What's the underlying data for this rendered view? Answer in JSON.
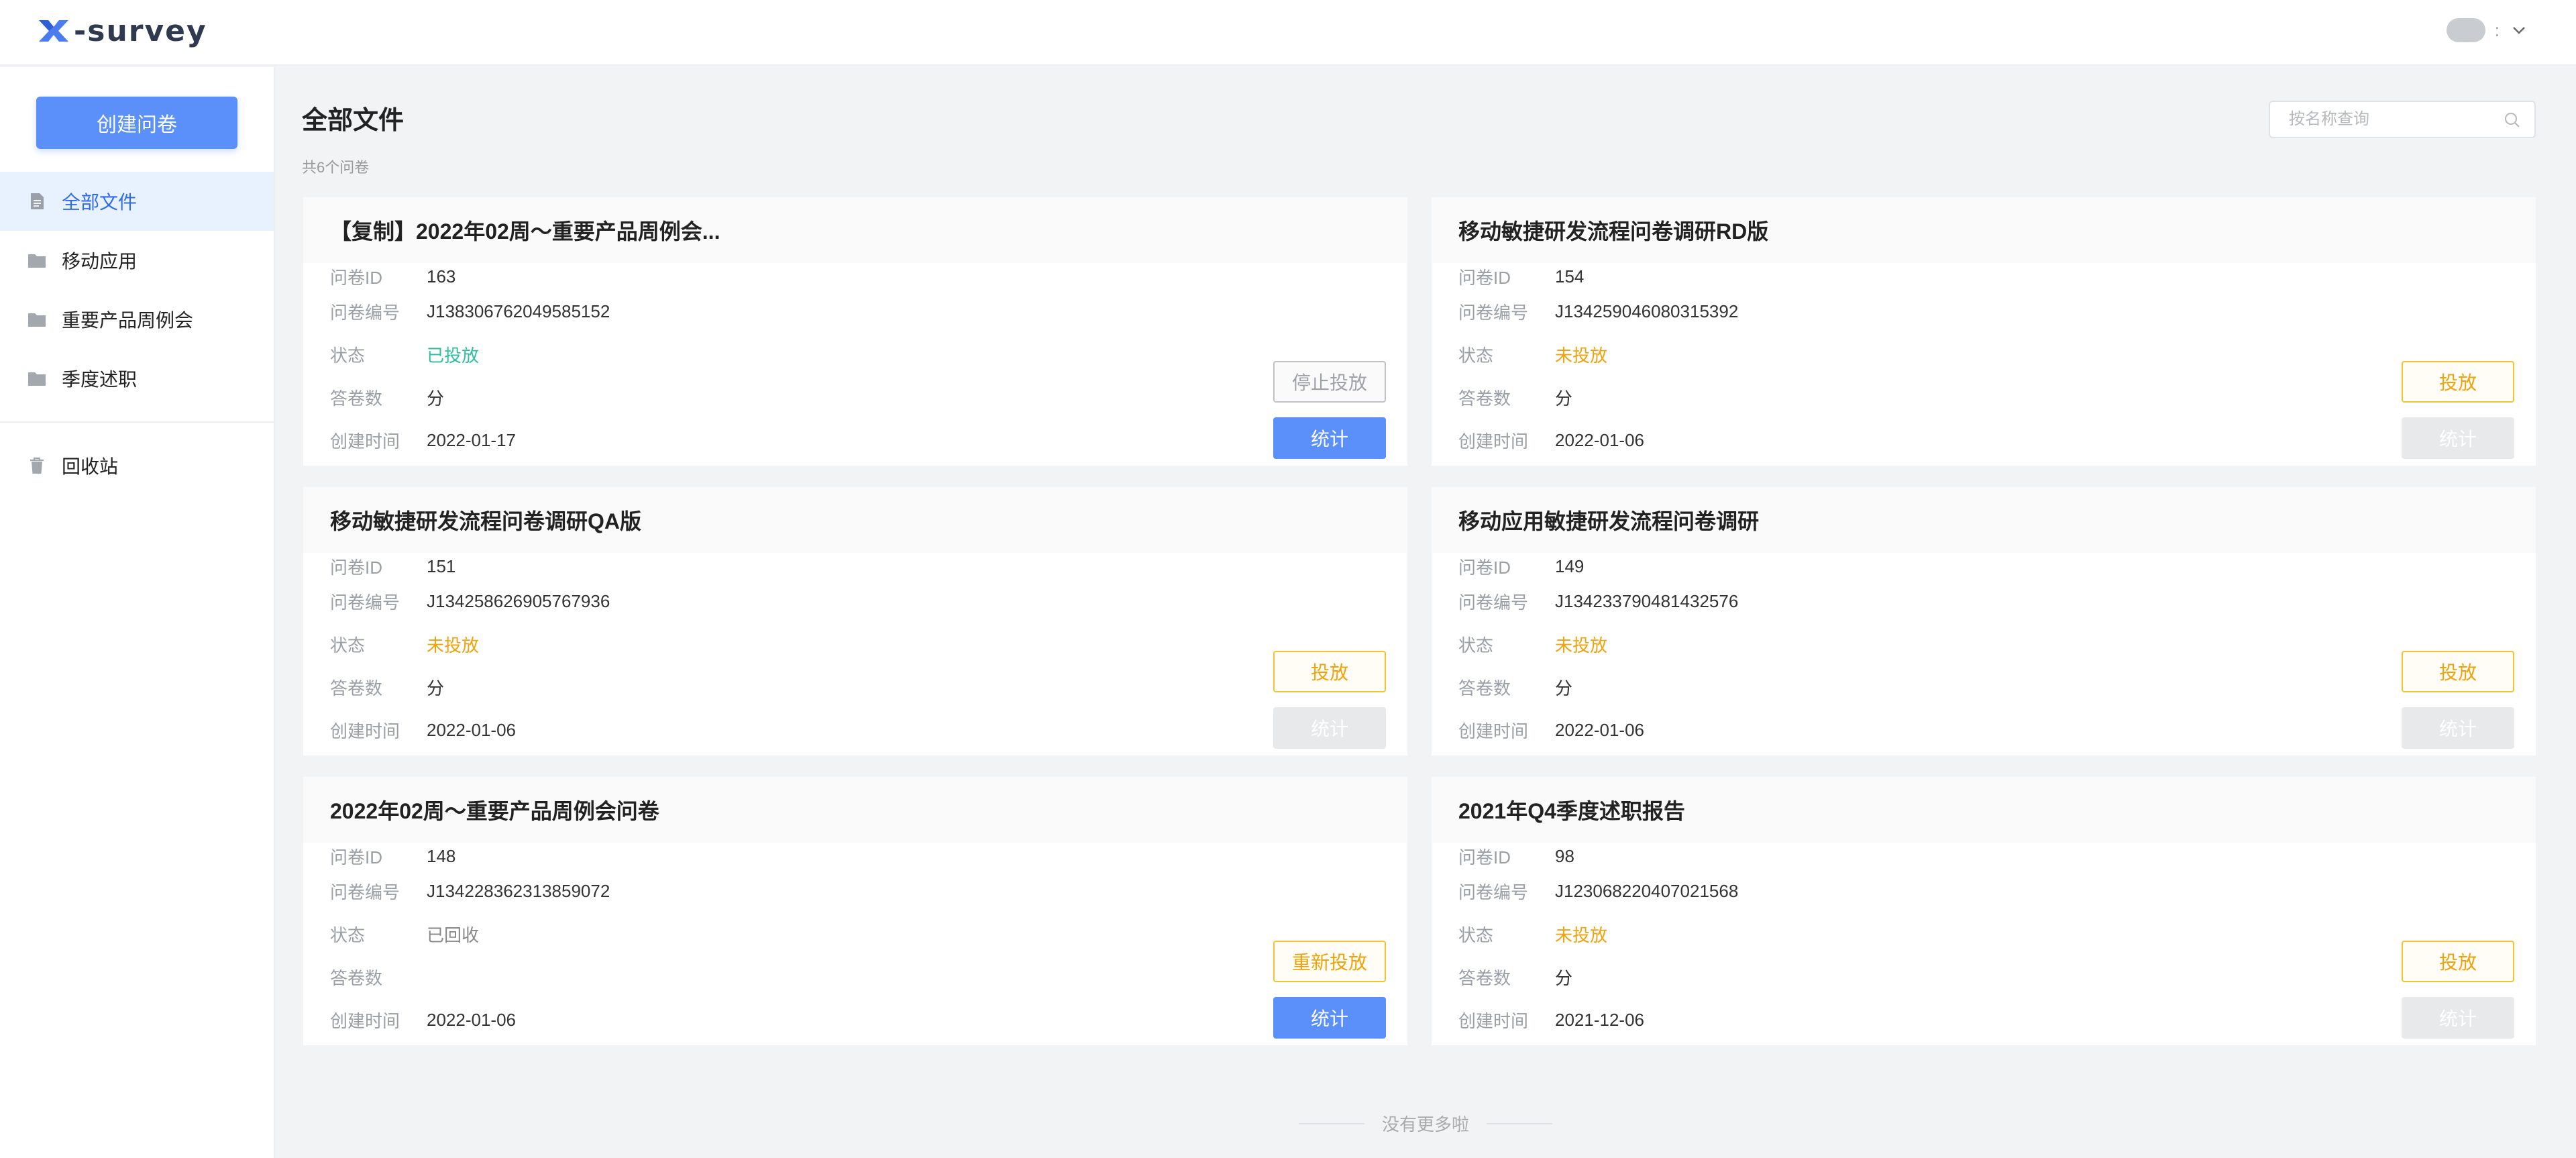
{
  "header": {
    "logo_text": "-survey",
    "user_dots": ":"
  },
  "colors": {
    "primary": "#5b8ff9",
    "active_nav_bg": "#e8f1fe",
    "status_published": "#2dbf9f",
    "status_unpublished": "#f0a20c"
  },
  "sidebar": {
    "create_button": "创建问卷",
    "items": [
      {
        "label": "全部文件",
        "icon": "document-icon",
        "active": true
      },
      {
        "label": "移动应用",
        "icon": "folder-icon"
      },
      {
        "label": "重要产品周例会",
        "icon": "folder-icon"
      },
      {
        "label": "季度述职",
        "icon": "folder-icon"
      }
    ],
    "trash": {
      "label": "回收站",
      "icon": "trash-icon"
    }
  },
  "main": {
    "title": "全部文件",
    "count_text": "共6个问卷",
    "search_placeholder": "按名称查询",
    "footer_note": "没有更多啦"
  },
  "field_labels": {
    "id": "问卷ID",
    "code": "问卷编号",
    "status": "状态",
    "answers": "答卷数",
    "created": "创建时间"
  },
  "cards": [
    {
      "title": "【复制】2022年02周～重要产品周例会...",
      "id": "163",
      "code": "J138306762049585152",
      "status": "已投放",
      "answers": "分",
      "created": "2022-01-17",
      "action_label": "停止投放",
      "stats_label": "统计"
    },
    {
      "title": "移动敏捷研发流程问卷调研RD版",
      "id": "154",
      "code": "J134259046080315392",
      "status": "未投放",
      "answers": "分",
      "created": "2022-01-06",
      "action_label": "投放",
      "stats_label": "统计"
    },
    {
      "title": "移动敏捷研发流程问卷调研QA版",
      "id": "151",
      "code": "J134258626905767936",
      "status": "未投放",
      "answers": "分",
      "created": "2022-01-06",
      "action_label": "投放",
      "stats_label": "统计"
    },
    {
      "title": "移动应用敏捷研发流程问卷调研",
      "id": "149",
      "code": "J134233790481432576",
      "status": "未投放",
      "answers": "分",
      "created": "2022-01-06",
      "action_label": "投放",
      "stats_label": "统计"
    },
    {
      "title": "2022年02周～重要产品周例会问卷",
      "id": "148",
      "code": "J134228362313859072",
      "status": "已回收",
      "answers": "",
      "created": "2022-01-06",
      "action_label": "重新投放",
      "stats_label": "统计"
    },
    {
      "title": "2021年Q4季度述职报告",
      "id": "98",
      "code": "J123068220407021568",
      "status": "未投放",
      "answers": "分",
      "created": "2021-12-06",
      "action_label": "投放",
      "stats_label": "统计"
    }
  ]
}
